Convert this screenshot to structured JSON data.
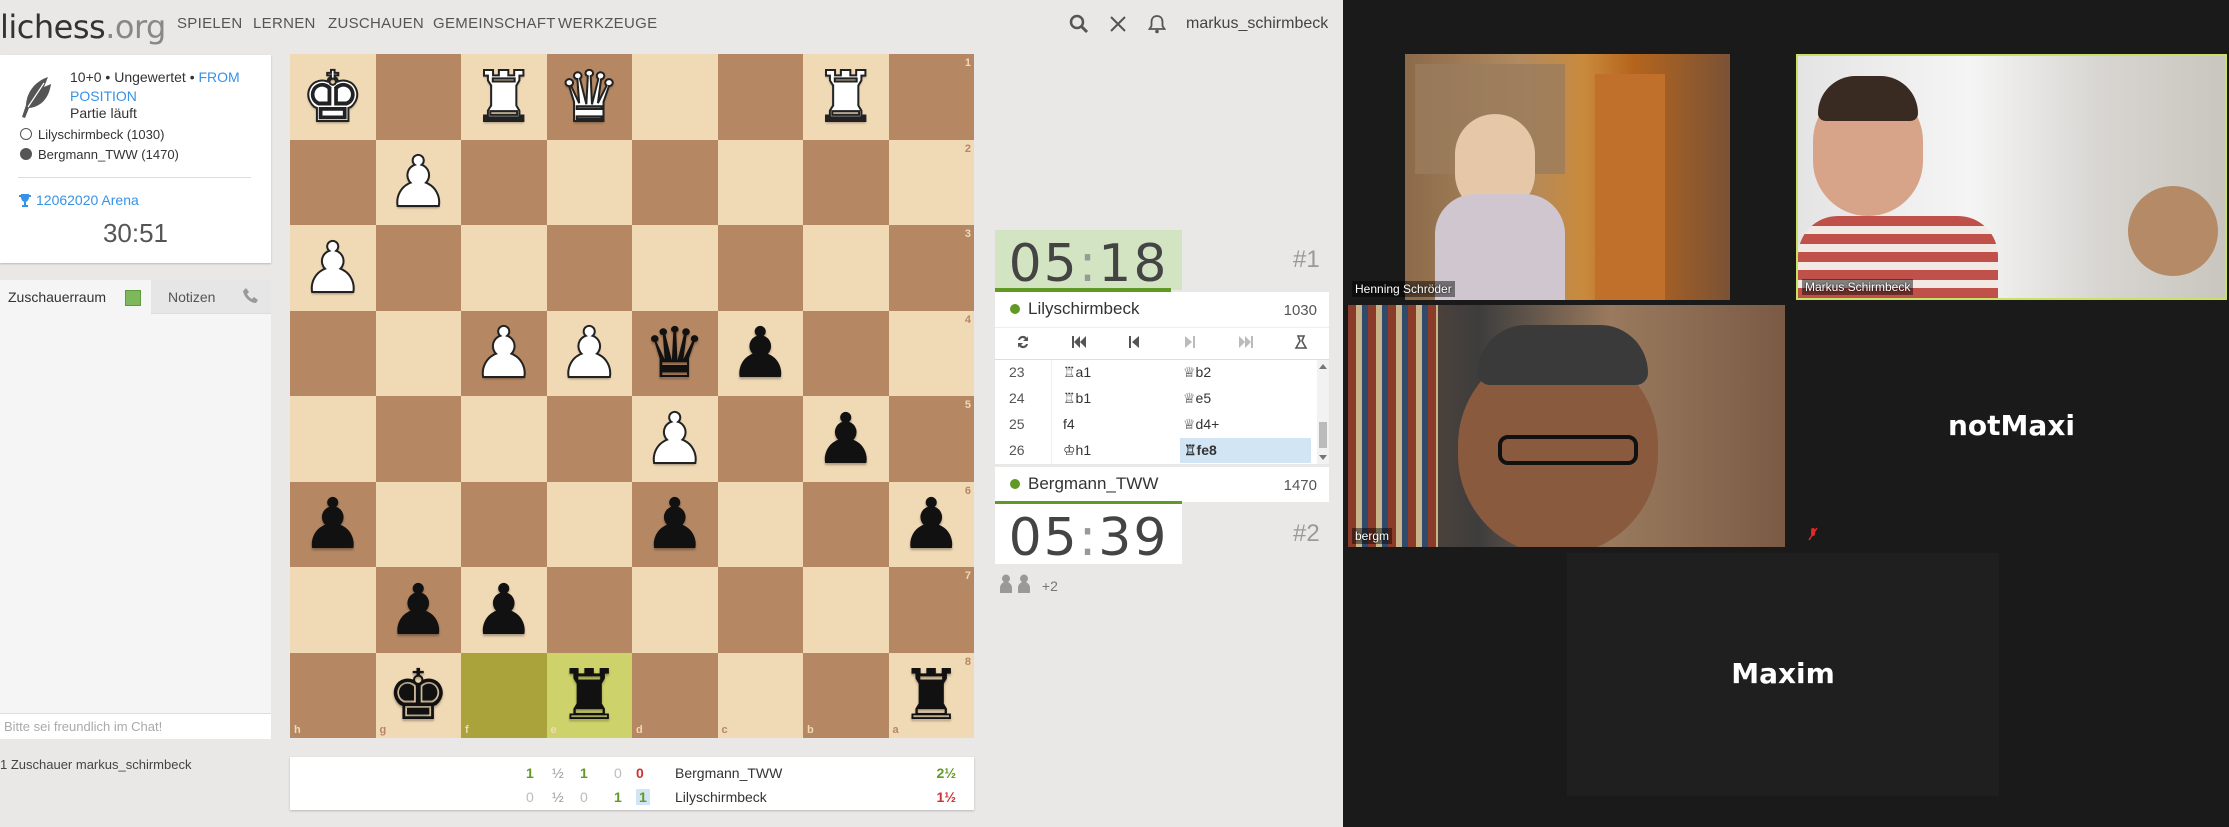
{
  "header": {
    "logo_main": "lichess",
    "logo_tld": ".org",
    "nav": [
      "SPIELEN",
      "LERNEN",
      "ZUSCHAUEN",
      "GEMEINSCHAFT",
      "WERKZEUGE"
    ],
    "username": "markus_schirmbeck"
  },
  "game_info": {
    "setup": "10+0 • Ungewertet • ",
    "setup_link": "FROM POSITION",
    "status": "Partie läuft",
    "white_player": "Lilyschirmbeck (1030)",
    "black_player": "Bergmann_TWW (1470)",
    "tournament": "12062020 Arena",
    "tournament_clock": "30:51"
  },
  "chat": {
    "tab_room": "Zuschauerraum",
    "tab_notes": "Notizen",
    "placeholder": "Bitte sei freundlich im Chat!",
    "spectators": "1 Zuschauer markus_schirmbeck"
  },
  "board": {
    "files": [
      "h",
      "g",
      "f",
      "e",
      "d",
      "c",
      "b",
      "a"
    ],
    "ranks": [
      "1",
      "2",
      "3",
      "4",
      "5",
      "6",
      "7",
      "8"
    ],
    "rows": [
      [
        "wK",
        "",
        "wR",
        "wQ",
        "",
        "",
        "wR",
        ""
      ],
      [
        "",
        "wP",
        "",
        "",
        "",
        "",
        "",
        ""
      ],
      [
        "wP",
        "",
        "",
        "",
        "",
        "",
        "",
        ""
      ],
      [
        "",
        "",
        "wP",
        "wP",
        "bQ",
        "bP",
        "",
        ""
      ],
      [
        "",
        "",
        "",
        "",
        "wP",
        "",
        "bP",
        ""
      ],
      [
        "bP",
        "",
        "",
        "",
        "bP",
        "",
        "",
        "bP"
      ],
      [
        "",
        "bP",
        "bP",
        "",
        "",
        "",
        "",
        ""
      ],
      [
        "",
        "bK",
        "",
        "bR",
        "",
        "",
        "",
        "bR"
      ]
    ],
    "highlight": [
      [
        7,
        2,
        "from"
      ],
      [
        7,
        3,
        "to"
      ]
    ]
  },
  "clocks": {
    "top": {
      "min": "05",
      "sec": "18",
      "running": true,
      "rank": "#1"
    },
    "bottom": {
      "min": "05",
      "sec": "39",
      "running": false,
      "rank": "#2"
    }
  },
  "players": {
    "top": {
      "name": "Lilyschirmbeck",
      "rating": "1030"
    },
    "bottom": {
      "name": "Bergmann_TWW",
      "rating": "1470"
    }
  },
  "moves": [
    {
      "n": "23",
      "w": "♖a1",
      "b": "♕b2"
    },
    {
      "n": "24",
      "w": "♖b1",
      "b": "♕e5"
    },
    {
      "n": "25",
      "w": "f4",
      "b": "♕d4+"
    },
    {
      "n": "26",
      "w": "♔h1",
      "b": "♖fe8"
    }
  ],
  "spectator_more": "+2",
  "crosstable": {
    "row1": {
      "a": "1",
      "b": "½",
      "c": "1",
      "d": "0",
      "e": "0",
      "name": "Bergmann_TWW",
      "score": "2½"
    },
    "row2": {
      "a": "0",
      "b": "½",
      "c": "0",
      "d": "1",
      "e": "1",
      "name": "Lilyschirmbeck",
      "score": "1½"
    }
  },
  "zoom": {
    "henning": "Henning Schröder",
    "markus": "Markus Schirmbeck",
    "bergm": "bergm",
    "notmaxi": "notMaxi",
    "maxim": "Maxim"
  },
  "colors": {
    "accent": "#629924",
    "link": "#3692e7",
    "light_square": "#f0d9b5",
    "dark_square": "#b58863"
  }
}
